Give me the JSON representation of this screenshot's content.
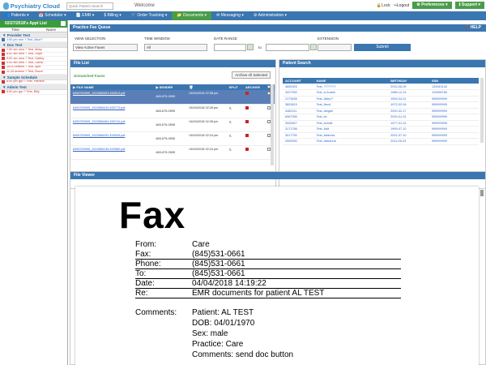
{
  "app": {
    "name": "Psychiatry Cloud"
  },
  "topbar": {
    "search_placeholder": "Quick Patient Search",
    "welcome": "Welcome",
    "lock": "Lock",
    "logout": "Logout",
    "preferences": "Preferences",
    "support": "Support"
  },
  "nav": [
    "Patients",
    "Scheduler",
    "EMR",
    "Billing",
    "Order Tracking",
    "Documents",
    "Messaging",
    "Administration"
  ],
  "left": {
    "header": "02/27/2018's Appt List",
    "col_time": "Time",
    "col_name": "Name",
    "groups": [
      {
        "title": "Provider Test",
        "appts": [
          {
            "time": "1:00 pm",
            "text": "min ? Test, Alice?",
            "kind": "b"
          }
        ]
      },
      {
        "title": "Doc Test",
        "appts": [
          {
            "time": "7:30 am",
            "text": "new ? Test, Abby",
            "kind": "r"
          },
          {
            "time": "8:00 am",
            "text": "new ? Test, Hope",
            "kind": "r"
          },
          {
            "time": "9:00 am",
            "text": "new ? Test, Gabby",
            "kind": "r"
          },
          {
            "time": "9:00 am",
            "text": "new ? Test, David",
            "kind": "r"
          },
          {
            "time": "10:00 am",
            "text": "new ? Test, Ajax",
            "kind": "r"
          },
          {
            "time": "11:15 am",
            "text": "new ? Test, Bruce",
            "kind": "r"
          }
        ]
      },
      {
        "title": "Sample Schedule",
        "appts": [
          {
            "time": "8:00 pm",
            "text": "grp ? Test, Pamela",
            "kind": "r"
          }
        ]
      },
      {
        "title": "Admin Test",
        "appts": [
          {
            "time": "9:00 pm",
            "text": "grp ? Test, Billy",
            "kind": "r"
          }
        ]
      }
    ]
  },
  "practice_queue": {
    "title": "Practice Fax Queue",
    "help": "HELP",
    "view_selection_label": "VIEW SELECTION",
    "view_selection_value": "View Active Faxes",
    "time_window_label": "TIME WINDOW",
    "time_window_value": "All",
    "date_range_label": "DATE RANGE",
    "to_label": "to",
    "extension_label": "EXTENSION",
    "submit": "Submit"
  },
  "file_list": {
    "title": "File List",
    "subtitle": "Unmatched Faxes",
    "archive_all": "Archive All Selected",
    "columns": [
      "FILE NAME",
      "SENDER",
      "",
      "SPLIT",
      "ARCHIVE",
      ""
    ],
    "rows": [
      {
        "file": "8455750595_1522865393.456513.pdf",
        "sender": "845-675-0595",
        "date": "04/04/2018 02:38 pm",
        "selected": true
      },
      {
        "file": "8455750595_1522866415.455773.pdf",
        "sender": "845-675-0595",
        "date": "04/04/2018 02:28 pm",
        "selected": false
      },
      {
        "file": "8455750595_1522866464.455744.pdf",
        "sender": "845-675-0595",
        "date": "04/04/2018 02:28 pm",
        "selected": false
      },
      {
        "file": "8455750595_1522866252.493639.pdf",
        "sender": "845-675-0595",
        "date": "04/04/2018 02:24 pm",
        "selected": false
      },
      {
        "file": "8455750595_1522866136.493580.pdf",
        "sender": "845-675-0595",
        "date": "04/04/2018 02:24 pm",
        "selected": false
      }
    ]
  },
  "patient_search": {
    "title": "Patient Search",
    "columns": [
      "ACCOUNT",
      "NAME",
      "BIRTHDAY",
      "SSN"
    ],
    "rows": [
      {
        "account": "4865325",
        "name": "Test, ???????",
        "birthday": "2015-06-09",
        "ssn": "134343142"
      },
      {
        "account": "4327930",
        "name": "Test, A.Andrei",
        "birthday": "1986-12-01",
        "ssn": "123456789"
      },
      {
        "account": "2173636",
        "name": "Test, Abby F",
        "birthday": "1994-04-01",
        "ssn": "999999999"
      },
      {
        "account": "3803619",
        "name": "Test, Abcd",
        "birthday": "1972-02-04",
        "ssn": "999999999"
      },
      {
        "account": "4482111",
        "name": "Test, Abigail",
        "birthday": "2000-02-17",
        "ssn": "999999999"
      },
      {
        "account": "6087936",
        "name": "Test, Ac",
        "birthday": "2000-01-01",
        "ssn": "999999999"
      },
      {
        "account": "3330827",
        "name": "Test, Achille",
        "birthday": "1977-01-01",
        "ssn": "999999999"
      },
      {
        "account": "3171786",
        "name": "Test, Add",
        "birthday": "1999-07-10",
        "ssn": "999999999"
      },
      {
        "account": "3017790",
        "name": "Test, Address",
        "birthday": "2001-07-10",
        "ssn": "999999999"
      },
      {
        "account": "2999930",
        "name": "Test, Adrianna",
        "birthday": "2011-05-23",
        "ssn": "999999999"
      }
    ]
  },
  "file_viewer": {
    "title": "File Viewer",
    "fax_title": "Fax",
    "fields": [
      {
        "k": "From:",
        "v": "Care"
      },
      {
        "k": "Fax:",
        "v": "(845)531-0661"
      },
      {
        "k": "Phone:",
        "v": "(845)531-0661"
      },
      {
        "k": "To:",
        "v": "(845)531-0661"
      },
      {
        "k": "Date:",
        "v": "04/04/2018 14:19:22"
      },
      {
        "k": "Re:",
        "v": "EMR documents for patient AL TEST"
      }
    ],
    "comments_label": "Comments:",
    "comments": [
      "Patient: AL TEST",
      "DOB: 04/01/1970",
      "Sex: male",
      "Practice: Care",
      "Comments: send doc button"
    ]
  },
  "colors": {
    "nav": "#3a76b0",
    "accent": "#4a9c4a",
    "selected_row": "#5a7fb8"
  }
}
